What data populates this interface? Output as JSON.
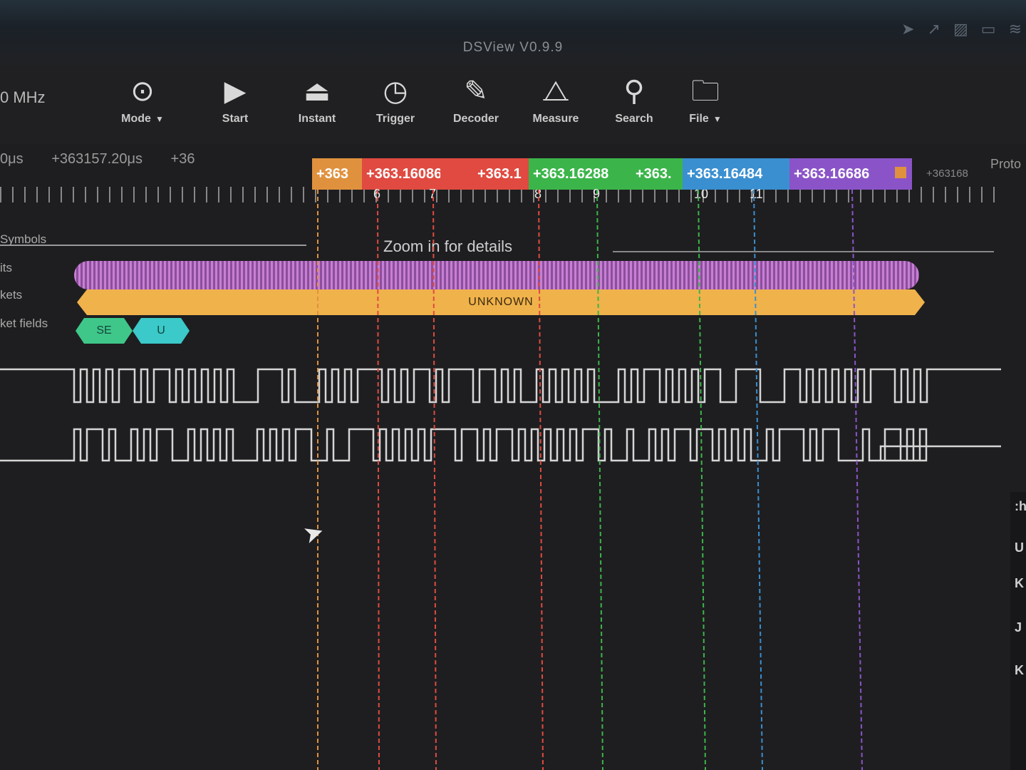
{
  "window": {
    "title": "DSView V0.9.9"
  },
  "toolbar": {
    "rate": "0 MHz",
    "tools": [
      {
        "name": "mode-button",
        "label": "Mode",
        "icon": "mode-icon",
        "glyph": "⊙",
        "dropdown": true
      },
      {
        "name": "start-button",
        "label": "Start",
        "icon": "play-icon",
        "glyph": "▶",
        "dropdown": false
      },
      {
        "name": "instant-button",
        "label": "Instant",
        "icon": "instant-icon",
        "glyph": "⏏",
        "dropdown": false
      },
      {
        "name": "trigger-button",
        "label": "Trigger",
        "icon": "trigger-icon",
        "glyph": "◷",
        "dropdown": false
      },
      {
        "name": "decoder-button",
        "label": "Decoder",
        "icon": "decoder-icon",
        "glyph": "✎",
        "dropdown": false
      },
      {
        "name": "measure-button",
        "label": "Measure",
        "icon": "measure-icon",
        "glyph": "⧍",
        "dropdown": false
      },
      {
        "name": "search-button",
        "label": "Search",
        "icon": "search-icon",
        "glyph": "⚲",
        "dropdown": false
      },
      {
        "name": "file-button",
        "label": "File",
        "icon": "file-icon",
        "glyph": "🗀",
        "dropdown": true
      }
    ]
  },
  "ruler": {
    "left_label": "0μs",
    "mid_label": "+363157.20μs",
    "mid2_label": "+36",
    "right_label": "+363168",
    "proto_label": "Proto"
  },
  "cursors": [
    {
      "label": "+363",
      "color": "#e0913e",
      "number": ""
    },
    {
      "label": "+363.16086",
      "color": "#e04a40",
      "number": "6"
    },
    {
      "label": "",
      "color": "#e04a40",
      "number": "7"
    },
    {
      "label": "+363.1",
      "color": "#e04a40",
      "number": "8"
    },
    {
      "label": "+363.16288",
      "color": "#3bb54a",
      "number": "9"
    },
    {
      "label": "+363.",
      "color": "#3bb54a",
      "number": "10"
    },
    {
      "label": "+363.16484",
      "color": "#3a8fd0",
      "number": "11"
    },
    {
      "label": "+363.16686",
      "color": "#8a54c8",
      "number": ""
    }
  ],
  "decoder": {
    "row_labels": {
      "symbols": "Symbols",
      "bits": "its",
      "packets": "kets",
      "fields": "ket fields"
    },
    "zoom_hint": "Zoom in for details",
    "packet": "UNKNOWN",
    "fields": [
      {
        "label": "SE",
        "color": "#3fc78a"
      },
      {
        "label": "U",
        "color": "#3bc9c9"
      }
    ]
  },
  "side_panel": {
    "items": [
      ":hi",
      "U",
      "K",
      "J",
      "K"
    ]
  },
  "colors": {
    "background": "#1e1e20",
    "wave": "#d6d6d6"
  }
}
